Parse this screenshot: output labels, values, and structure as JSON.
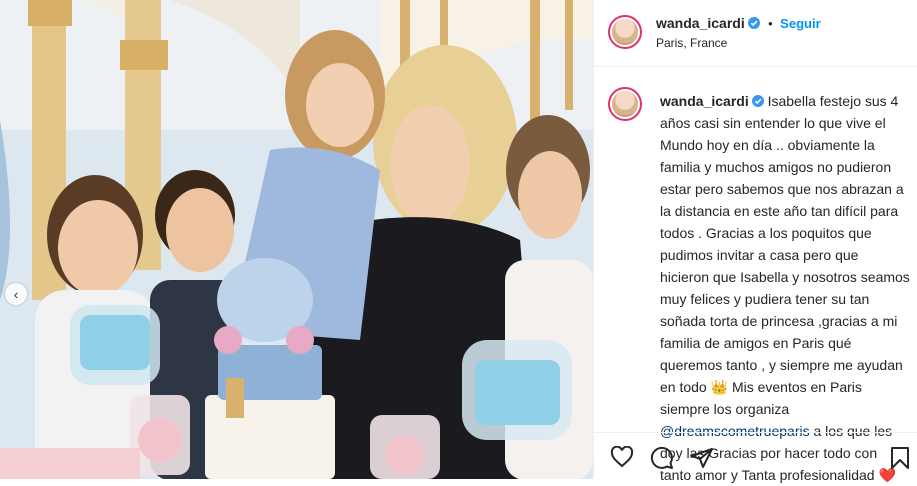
{
  "post": {
    "username": "wanda_icardi",
    "follow_label": "Seguir",
    "separator": "•",
    "location": "Paris, France"
  },
  "caption": {
    "username": "wanda_icardi",
    "part1": "Isabella festejo sus 4 años casi sin entender lo que vive el Mundo hoy en día .. obviamente la familia y muchos amigos no pudieron estar pero sabemos que nos abrazan a la distancia en este año tan difícil para todos . Gracias a los poquitos que pudimos invitar a casa pero que hicieron que Isabella y nosotros seamos muy felices y pudiera tener su tan soñada torta de princesa ,gracias a mi familia de amigos en Paris qué queremos tanto , y siempre me ayudan en todo",
    "crown_emoji": "👑",
    "part2": "Mis eventos en Paris siempre los organiza",
    "mention": "@dreamscometrueparis",
    "part3": "a los que les doy las Gracias por hacer todo con tanto amor y Tanta profesionalidad",
    "heart_emoji": "❤️"
  },
  "photo": {
    "alt_icons": [
      "photo-content"
    ],
    "prev_arrow": "‹"
  },
  "colors": {
    "follow": "#0095f6",
    "mention": "#00376b",
    "verified": "#3897f0",
    "ring": "#e1306c"
  }
}
